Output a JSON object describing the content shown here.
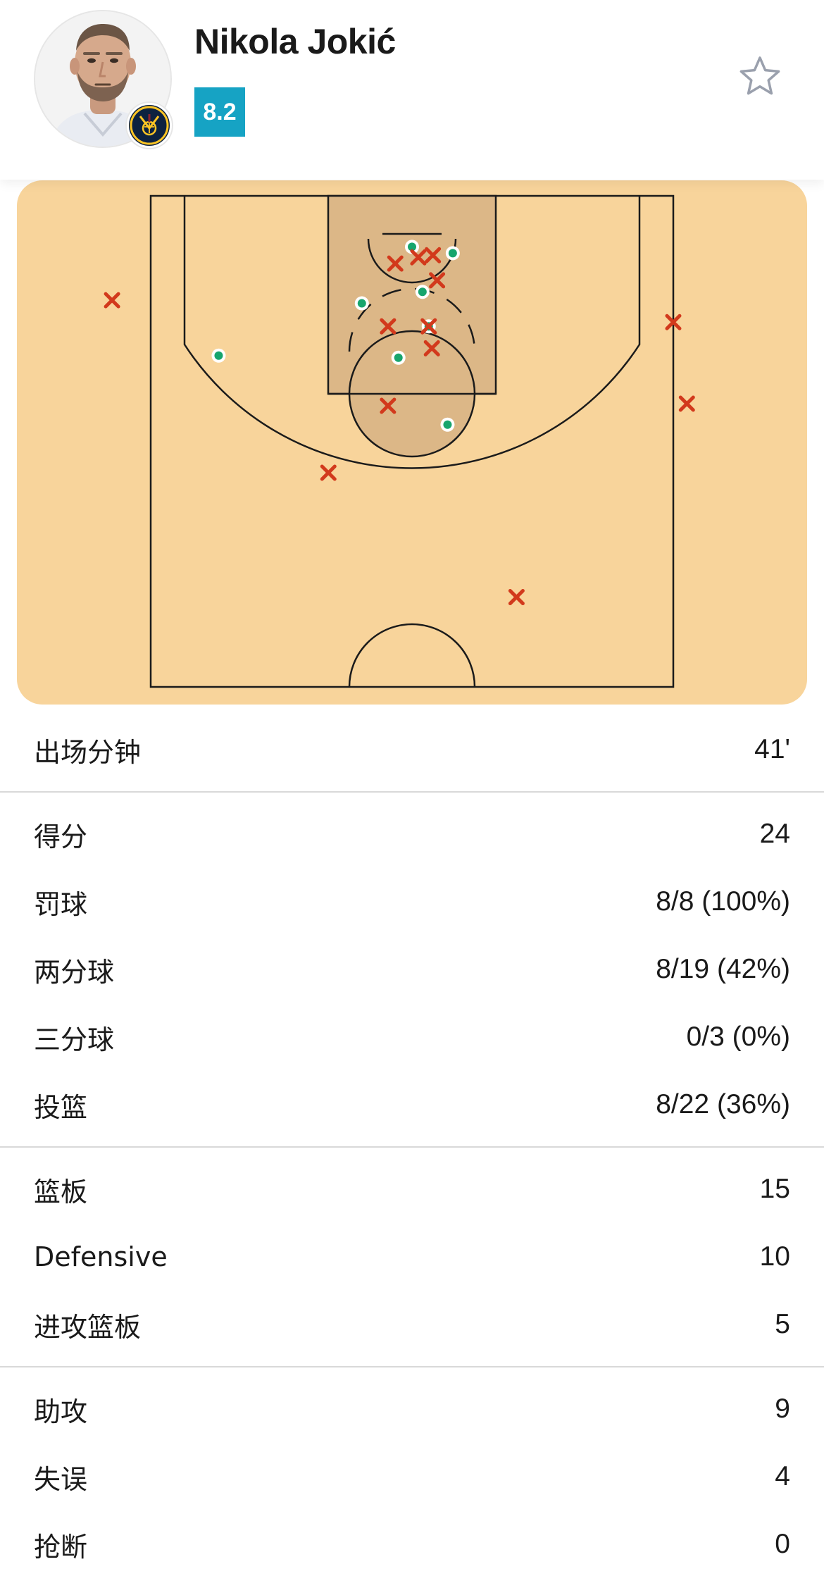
{
  "player": {
    "name": "Nikola Jokić",
    "rating": "8.2"
  },
  "colors": {
    "rating_bg": "#16a3c4",
    "court": "#f8d49b",
    "paint": "#dcb787",
    "made": "#17a56d",
    "missed": "#d2391c"
  },
  "icons": {
    "favorite": "star-outline-icon",
    "team": "nuggets-logo"
  },
  "shot_chart": {
    "made": [
      {
        "x": 0,
        "y": 0.5
      },
      {
        "x": 3.9,
        "y": 1.1
      },
      {
        "x": -4.8,
        "y": 5.9
      },
      {
        "x": 1.0,
        "y": 4.8
      },
      {
        "x": 1.6,
        "y": 8.1
      },
      {
        "x": -1.3,
        "y": 11.1
      },
      {
        "x": 3.4,
        "y": 17.5
      },
      {
        "x": -18.5,
        "y": 10.9
      }
    ],
    "missed": [
      {
        "x": -1.6,
        "y": 2.1
      },
      {
        "x": 2.0,
        "y": 1.3
      },
      {
        "x": 0.6,
        "y": 1.5
      },
      {
        "x": 2.4,
        "y": 3.7
      },
      {
        "x": -2.3,
        "y": 8.1
      },
      {
        "x": 1.6,
        "y": 8.1
      },
      {
        "x": 1.9,
        "y": 10.2
      },
      {
        "x": -2.3,
        "y": 15.7
      },
      {
        "x": -8.0,
        "y": 22.1
      },
      {
        "x": 10.0,
        "y": 34.0
      },
      {
        "x": -28.7,
        "y": 5.6
      },
      {
        "x": 25.0,
        "y": 7.7
      },
      {
        "x": 26.3,
        "y": 15.5
      }
    ]
  },
  "stats_groups": [
    [
      {
        "label": "出场分钟",
        "value": "41'"
      }
    ],
    [
      {
        "label": "得分",
        "value": "24"
      },
      {
        "label": "罚球",
        "value": "8/8 (100%)"
      },
      {
        "label": "两分球",
        "value": "8/19 (42%)"
      },
      {
        "label": "三分球",
        "value": "0/3 (0%)"
      },
      {
        "label": "投篮",
        "value": "8/22 (36%)"
      }
    ],
    [
      {
        "label": "篮板",
        "value": "15"
      },
      {
        "label": "Defensive",
        "value": "10"
      },
      {
        "label": "进攻篮板",
        "value": "5"
      }
    ],
    [
      {
        "label": "助攻",
        "value": "9"
      },
      {
        "label": "失误",
        "value": "4"
      },
      {
        "label": "抢断",
        "value": "0"
      }
    ]
  ]
}
